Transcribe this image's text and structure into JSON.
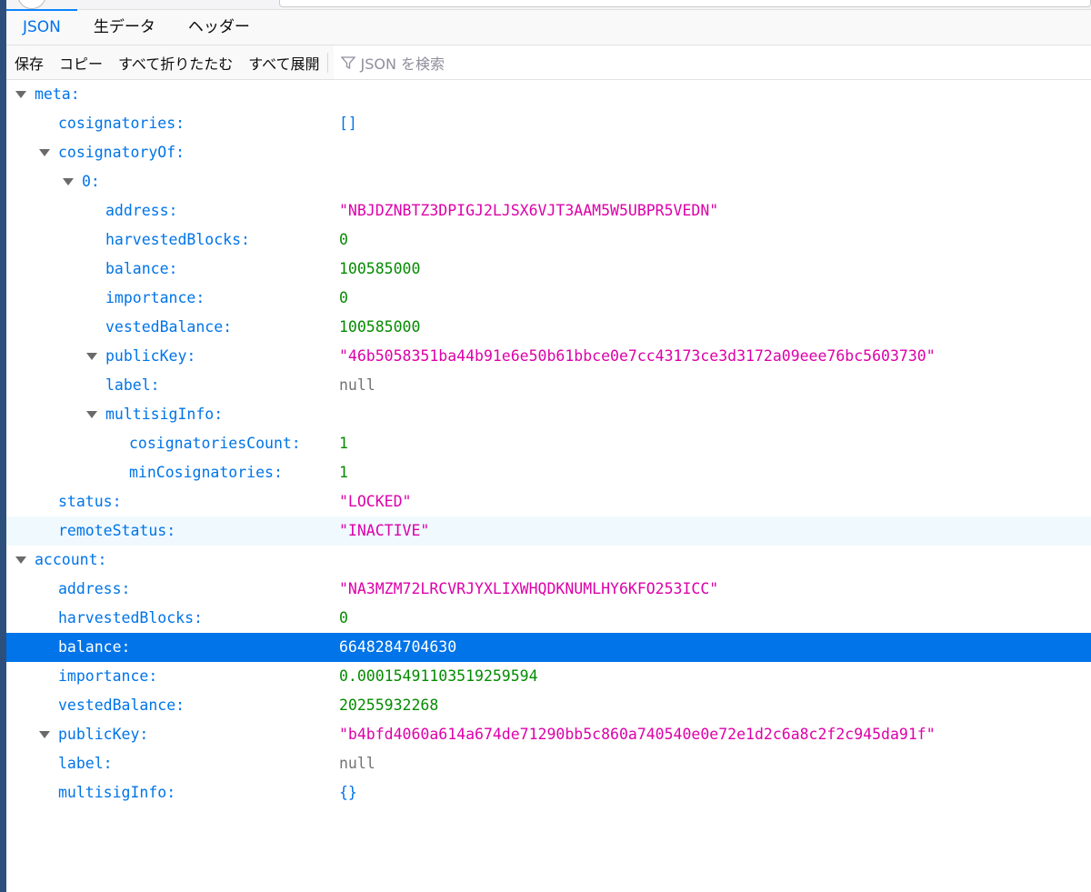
{
  "tabs": [
    {
      "label": "JSON",
      "selected": true
    },
    {
      "label": "生データ",
      "selected": false
    },
    {
      "label": "ヘッダー",
      "selected": false
    }
  ],
  "toolbar": {
    "save": "保存",
    "copy": "コピー",
    "collapse_all": "すべて折りたたむ",
    "expand_all": "すべて展開",
    "filter_placeholder": "JSON を検索"
  },
  "colors": {
    "accent": "#0074e8",
    "string": "#dd00a9",
    "number": "#058b00",
    "null": "#737373"
  },
  "rows": [
    {
      "depth": 0,
      "key": "meta:",
      "toggle": true
    },
    {
      "depth": 1,
      "key": "cosignatories:",
      "value": "[]",
      "type": "obj"
    },
    {
      "depth": 1,
      "key": "cosignatoryOf:",
      "toggle": true
    },
    {
      "depth": 2,
      "key": "0:",
      "toggle": true
    },
    {
      "depth": 3,
      "key": "address:",
      "value": "\"NBJDZNBTZ3DPIGJ2LJSX6VJT3AAM5W5UBPR5VEDN\"",
      "type": "string"
    },
    {
      "depth": 3,
      "key": "harvestedBlocks:",
      "value": "0",
      "type": "number"
    },
    {
      "depth": 3,
      "key": "balance:",
      "value": "100585000",
      "type": "number"
    },
    {
      "depth": 3,
      "key": "importance:",
      "value": "0",
      "type": "number"
    },
    {
      "depth": 3,
      "key": "vestedBalance:",
      "value": "100585000",
      "type": "number"
    },
    {
      "depth": 3,
      "key": "publicKey:",
      "value": "\"46b5058351ba44b91e6e50b61bbce0e7cc43173ce3d3172a09eee76bc5603730\"",
      "type": "string",
      "toggle": true
    },
    {
      "depth": 3,
      "key": "label:",
      "value": "null",
      "type": "null"
    },
    {
      "depth": 3,
      "key": "multisigInfo:",
      "toggle": true
    },
    {
      "depth": 4,
      "key": "cosignatoriesCount:",
      "value": "1",
      "type": "number"
    },
    {
      "depth": 4,
      "key": "minCosignatories:",
      "value": "1",
      "type": "number"
    },
    {
      "depth": 1,
      "key": "status:",
      "value": "\"LOCKED\"",
      "type": "string"
    },
    {
      "depth": 1,
      "key": "remoteStatus:",
      "value": "\"INACTIVE\"",
      "type": "string",
      "state": "hover"
    },
    {
      "depth": 0,
      "key": "account:",
      "toggle": true
    },
    {
      "depth": 1,
      "key": "address:",
      "value": "\"NA3MZM72LRCVRJYXLIXWHQDKNUMLHY6KFO253ICC\"",
      "type": "string"
    },
    {
      "depth": 1,
      "key": "harvestedBlocks:",
      "value": "0",
      "type": "number"
    },
    {
      "depth": 1,
      "key": "balance:",
      "value": "6648284704630",
      "type": "number",
      "state": "selected"
    },
    {
      "depth": 1,
      "key": "importance:",
      "value": "0.00015491103519259594",
      "type": "number"
    },
    {
      "depth": 1,
      "key": "vestedBalance:",
      "value": "20255932268",
      "type": "number"
    },
    {
      "depth": 1,
      "key": "publicKey:",
      "value": "\"b4bfd4060a614a674de71290bb5c860a740540e0e72e1d2c6a8c2f2c945da91f\"",
      "type": "string",
      "toggle": true
    },
    {
      "depth": 1,
      "key": "label:",
      "value": "null",
      "type": "null"
    },
    {
      "depth": 1,
      "key": "multisigInfo:",
      "value": "{}",
      "type": "obj"
    }
  ]
}
